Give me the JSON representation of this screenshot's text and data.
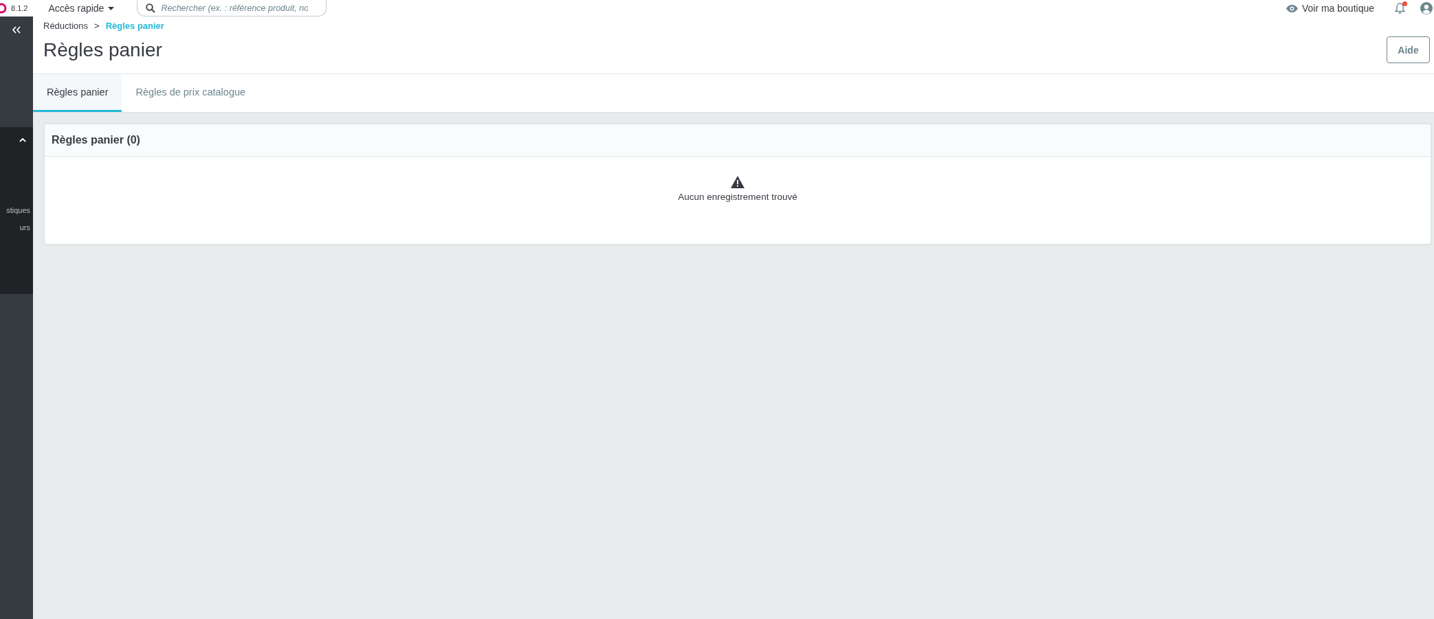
{
  "topbar": {
    "version": "8.1.2",
    "quick_access": "Accès rapide",
    "search": {
      "placeholder": "Rechercher (ex. : référence produit, no"
    },
    "shop_link": "Voir ma boutique",
    "notifications": {
      "unread": true
    }
  },
  "sidebar": {
    "items": [
      {
        "label": "stiques"
      },
      {
        "label": "urs"
      }
    ]
  },
  "breadcrumb": [
    {
      "label": "Réductions",
      "current": false
    },
    {
      "label": "Règles panier",
      "current": true
    }
  ],
  "breadcrumb_separator": ">",
  "page_title": "Règles panier",
  "help_button": "Aide",
  "tabs": [
    {
      "label": "Règles panier",
      "selected": true
    },
    {
      "label": "Règles de prix catalogue",
      "selected": false
    }
  ],
  "panel": {
    "title": "Règles panier (0)",
    "empty_message": "Aucun enregistrement trouvé"
  }
}
